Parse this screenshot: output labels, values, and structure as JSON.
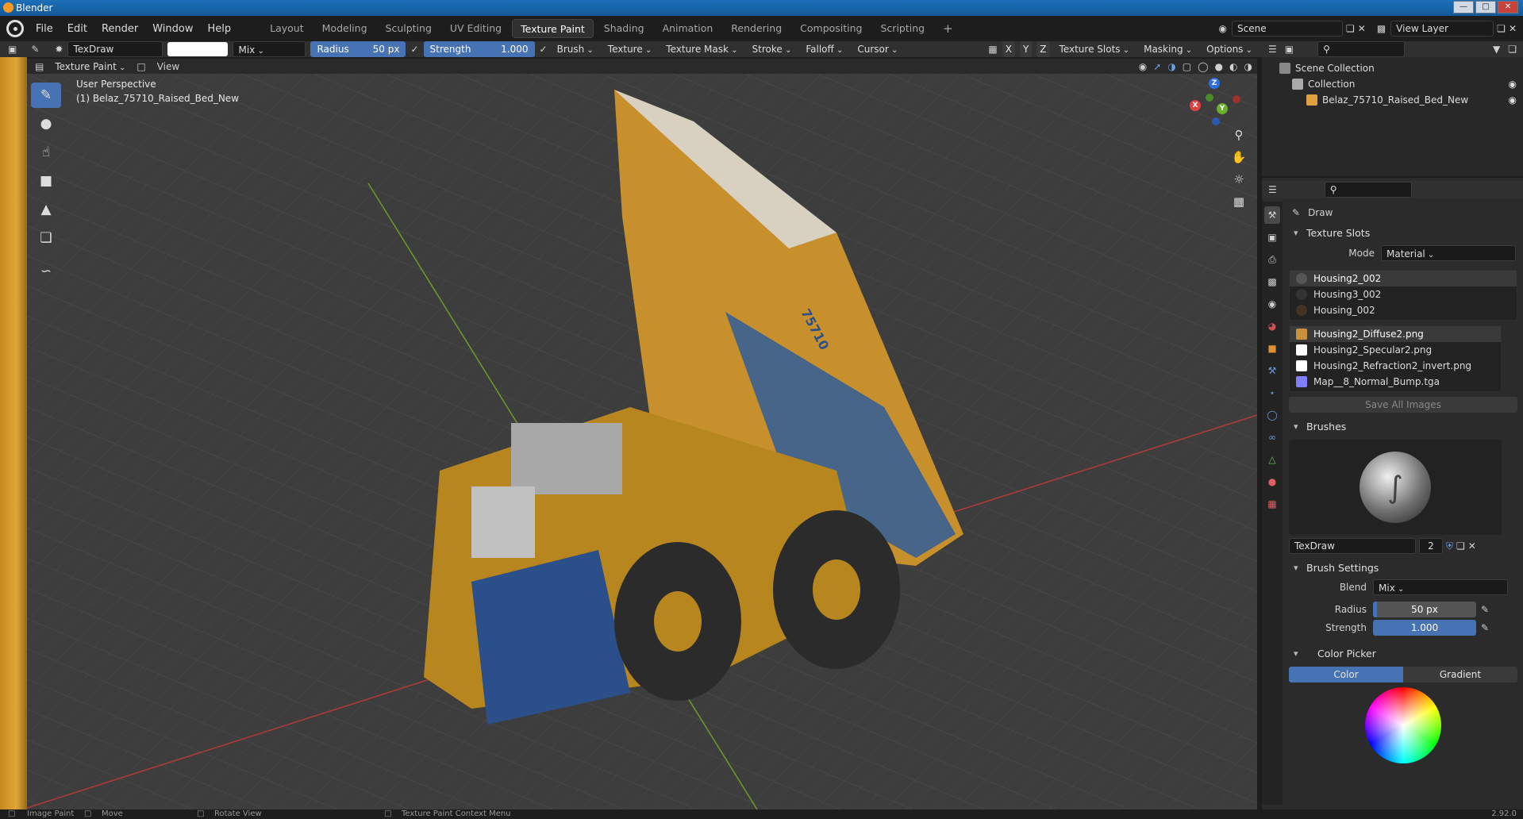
{
  "window": {
    "title": "Blender"
  },
  "menus": [
    "File",
    "Edit",
    "Render",
    "Window",
    "Help"
  ],
  "workspaces": [
    "Layout",
    "Modeling",
    "Sculpting",
    "UV Editing",
    "Texture Paint",
    "Shading",
    "Animation",
    "Rendering",
    "Compositing",
    "Scripting"
  ],
  "active_workspace_index": 4,
  "scene": {
    "name": "Scene",
    "view_layer": "View Layer"
  },
  "tool_header": {
    "brush_name": "TexDraw",
    "blend": "Mix",
    "radius_label": "Radius",
    "radius_value": "50 px",
    "strength_label": "Strength",
    "strength_value": "1.000",
    "menus": [
      "Brush",
      "Texture",
      "Texture Mask",
      "Stroke",
      "Falloff",
      "Cursor"
    ],
    "axis": [
      "X",
      "Y",
      "Z"
    ],
    "right_menus": [
      "Texture Slots",
      "Masking",
      "Options"
    ]
  },
  "editor_header": {
    "mode": "Texture Paint",
    "view_menu": "View"
  },
  "viewport": {
    "perspective": "User Perspective",
    "object_label": "(1) Belaz_75710_Raised_Bed_New",
    "truck_number": "75710"
  },
  "outliner": {
    "scene_collection": "Scene Collection",
    "collection": "Collection",
    "object": "Belaz_75710_Raised_Bed_New"
  },
  "properties": {
    "tool_name": "Draw",
    "texture_slots_title": "Texture Slots",
    "mode_label": "Mode",
    "mode_value": "Material",
    "materials": [
      "Housing2_002",
      "Housing3_002",
      "Housing_002"
    ],
    "images": [
      {
        "name": "Housing2_Diffuse2.png",
        "color": "#c8903a"
      },
      {
        "name": "Housing2_Specular2.png",
        "color": "#ffffff"
      },
      {
        "name": "Housing2_Refraction2_invert.png",
        "color": "#ffffff"
      },
      {
        "name": "Map__8_Normal_Bump.tga",
        "color": "#8080ff"
      }
    ],
    "save_all": "Save All Images",
    "brushes_title": "Brushes",
    "brush_name": "TexDraw",
    "brush_users": "2",
    "brush_settings_title": "Brush Settings",
    "blend_label": "Blend",
    "blend_value": "Mix",
    "radius_label": "Radius",
    "radius_value": "50 px",
    "strength_label": "Strength",
    "strength_value": "1.000",
    "color_picker_title": "Color Picker",
    "color_tab": "Color",
    "gradient_tab": "Gradient"
  },
  "statusbar": {
    "left_mouse": "Image Paint",
    "middle_mouse": "Move",
    "rotate": "Rotate View",
    "context": "Texture Paint Context Menu",
    "version": "2.92.0"
  }
}
